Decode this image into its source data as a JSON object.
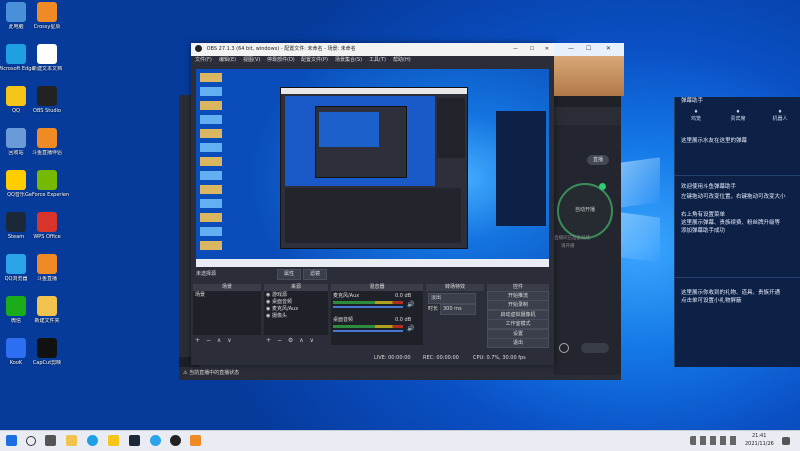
{
  "desktop_icons": [
    {
      "label": "此电脑",
      "color": "#4a90d9"
    },
    {
      "label": "Crossy星辰",
      "color": "#f08a24"
    },
    {
      "label": "Microsoft Edge",
      "color": "#1fa0e3"
    },
    {
      "label": "新建文本文档",
      "color": "#ffffff"
    },
    {
      "label": "QQ",
      "color": "#f5c518"
    },
    {
      "label": "OBS Studio",
      "color": "#222222"
    },
    {
      "label": "回收站",
      "color": "#6a9bd8"
    },
    {
      "label": "斗鱼直播伴侣",
      "color": "#f08a24"
    },
    {
      "label": "QQ音乐",
      "color": "#ffcc00"
    },
    {
      "label": "GeForce Experience",
      "color": "#76b900"
    },
    {
      "label": "Steam",
      "color": "#1b2838"
    },
    {
      "label": "WPS Office",
      "color": "#d9342b"
    },
    {
      "label": "QQ浏览器",
      "color": "#2aa3e8"
    },
    {
      "label": "斗鱼直播",
      "color": "#f08a24"
    },
    {
      "label": "微信",
      "color": "#1aad19"
    },
    {
      "label": "新建文件夹",
      "color": "#f2c24f"
    },
    {
      "label": "KooK",
      "color": "#2e6ff2"
    },
    {
      "label": "CapCut剪映",
      "color": "#111111"
    }
  ],
  "obs": {
    "title": "OBS 27.1.3 (64 bit, windows) - 配置文件: 未命名 - 场景: 未命名",
    "menu": [
      "文件(F)",
      "编辑(E)",
      "视图(V)",
      "停靠部件(D)",
      "配置文件(P)",
      "场景集合(S)",
      "工具(T)",
      "帮助(H)"
    ],
    "no_source": "未选择源",
    "props_btn": "属性",
    "filters_btn": "滤镜",
    "panels": {
      "scenes": "场景",
      "sources": "来源",
      "mixer": "混音器",
      "transitions": "转场特效",
      "controls": "控件"
    },
    "scene_items": [
      "场景"
    ],
    "source_items": [
      "游戏源",
      "桌面音频",
      "麦克风/Aux",
      "摄像头"
    ],
    "mixer_tracks": [
      {
        "name": "麦克风/Aux",
        "db": "0.0 dB"
      },
      {
        "name": "桌面音频",
        "db": "0.0 dB"
      }
    ],
    "transition": {
      "type": "淡出",
      "duration_label": "时长",
      "duration": "300 ms"
    },
    "controls": [
      "开始推流",
      "开始录制",
      "启动虚拟摄像机",
      "工作室模式",
      "设置",
      "退出"
    ],
    "status": {
      "live": "LIVE: 00:00:00",
      "rec": "REC: 00:00:00",
      "cpu": "CPU: 0.7%, 30.00 fps"
    }
  },
  "douyu": {
    "start_btn": "自动开播",
    "live_btn": "直播",
    "hint1": "直播间已准备就绪",
    "hint2": "请开播",
    "bottom_note": "⚠ 当前直播中的直播状态"
  },
  "chat": {
    "title": "弹幕助手",
    "tabs": [
      "鸡笼",
      "贵宾席",
      "机器人"
    ],
    "welcome": "这里展示水友在这里的弹幕",
    "msg1": "欢迎使用斗鱼弹幕助手",
    "msg2": "左键拖动可改变位置，右键拖动可改变大小",
    "msg3": "右上角有设置菜单",
    "msg4": "这里展示弹幕、贵族续费、粉丝牌升级等",
    "msg5": "添加弹幕助手成功",
    "msg6": "这里展示你收到的礼物、道具、贵族开通",
    "msg7": "点击单可设置小礼物屏蔽"
  },
  "taskbar": {
    "time": "21:41",
    "date": "2021/11/26"
  }
}
